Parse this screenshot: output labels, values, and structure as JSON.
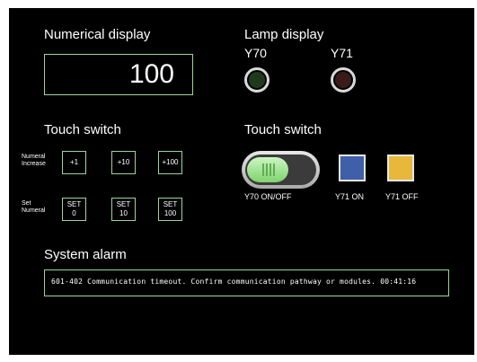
{
  "numerical_display": {
    "title": "Numerical display",
    "value": "100"
  },
  "lamp_display": {
    "title": "Lamp display",
    "lamps": [
      {
        "label": "Y70",
        "color": "#1d3a1d"
      },
      {
        "label": "Y71",
        "color": "#3a1a1a"
      }
    ]
  },
  "touch_switch_left": {
    "title": "Touch switch",
    "numeral_increase": {
      "label_line1": "Numeral",
      "label_line2": "Increase",
      "buttons": [
        "+1",
        "+10",
        "+100"
      ]
    },
    "set_numeral": {
      "label_line1": "Set",
      "label_line2": "Numeral",
      "buttons": [
        [
          "SET",
          "0"
        ],
        [
          "SET",
          "10"
        ],
        [
          "SET",
          "100"
        ]
      ]
    }
  },
  "touch_switch_right": {
    "title": "Touch switch",
    "toggle_label": "Y70 ON/OFF",
    "y71_on": {
      "label": "Y71 ON",
      "color": "#3f5fa8"
    },
    "y71_off": {
      "label": "Y71 OFF",
      "color": "#e8b83a"
    }
  },
  "system_alarm": {
    "title": "System alarm",
    "message": "601-402 Communication timeout. Confirm communication pathway or modules. 00:41:16"
  }
}
